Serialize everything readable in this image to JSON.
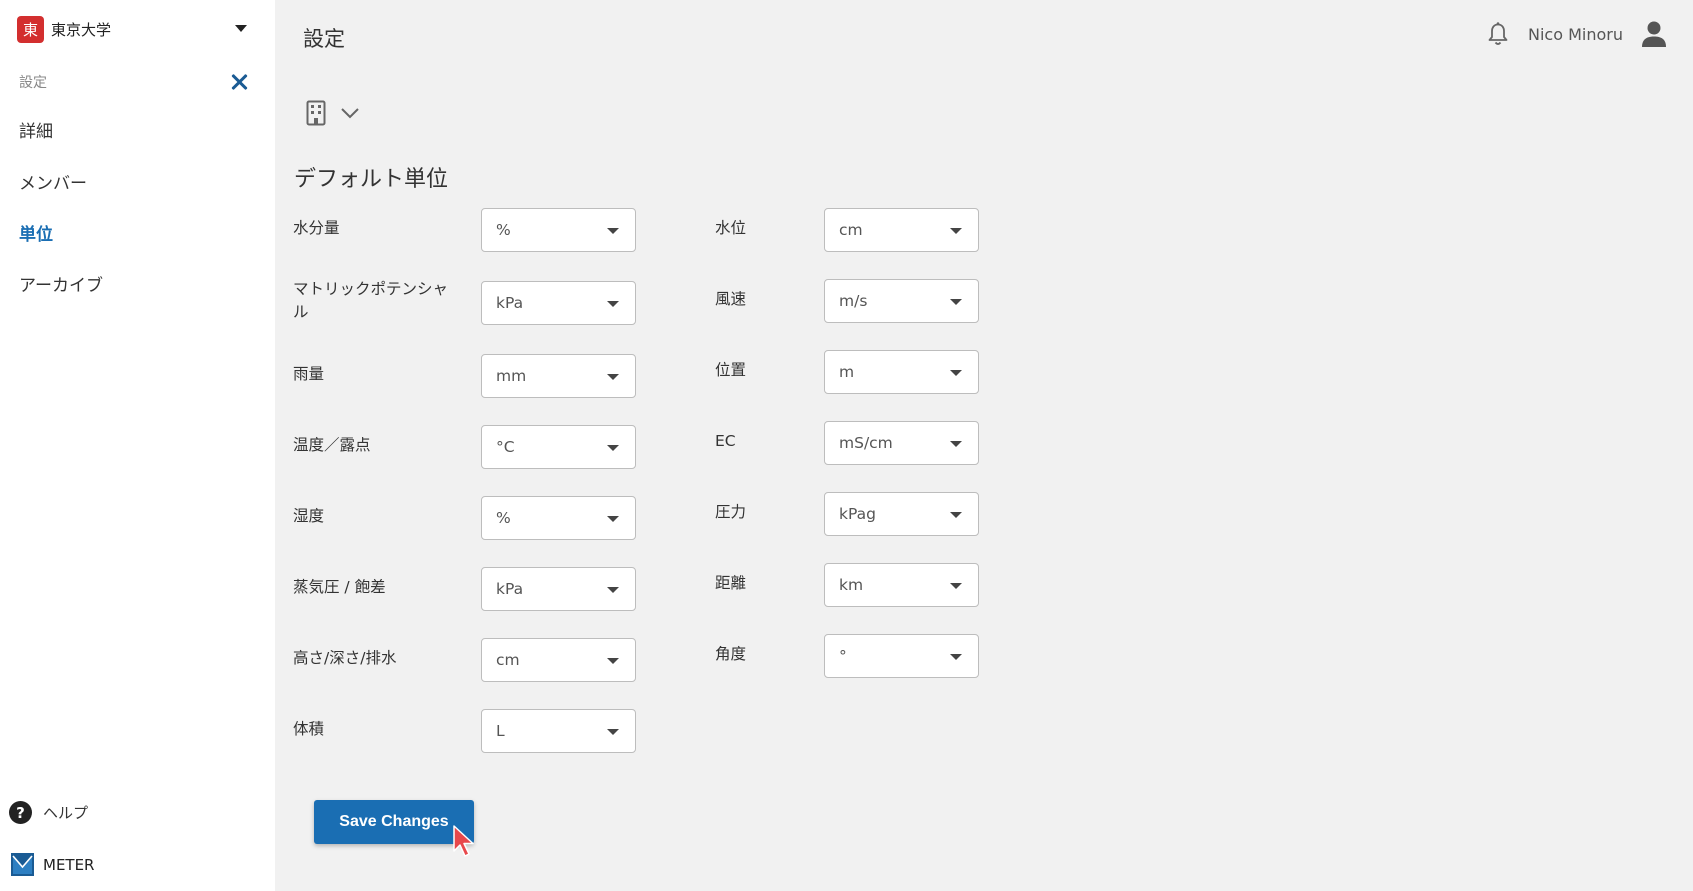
{
  "sidebar": {
    "org_logo": "東",
    "org_name": "東京大学",
    "section_title": "設定",
    "items": [
      {
        "label": "詳細"
      },
      {
        "label": "メンバー"
      },
      {
        "label": "単位",
        "active": true
      },
      {
        "label": "アーカイブ"
      }
    ],
    "help_label": "ヘルプ",
    "help_glyph": "?",
    "brand_label": "METER"
  },
  "header": {
    "title": "設定",
    "user_name": "Nico Minoru"
  },
  "main": {
    "heading": "デフォルト単位",
    "left_fields": [
      {
        "label": "水分量",
        "value": "%"
      },
      {
        "label": "マトリックポテンシャル",
        "value": "kPa"
      },
      {
        "label": "雨量",
        "value": "mm"
      },
      {
        "label": "温度／露点",
        "value": "°C"
      },
      {
        "label": "湿度",
        "value": "%"
      },
      {
        "label": "蒸気圧 / 飽差",
        "value": "kPa"
      },
      {
        "label": "高さ/深さ/排水",
        "value": "cm"
      },
      {
        "label": "体積",
        "value": "L"
      }
    ],
    "right_fields": [
      {
        "label": "水位",
        "value": "cm"
      },
      {
        "label": "風速",
        "value": "m/s"
      },
      {
        "label": "位置",
        "value": "m"
      },
      {
        "label": "EC",
        "value": "mS/cm"
      },
      {
        "label": "圧力",
        "value": "kPag"
      },
      {
        "label": "距離",
        "value": "km"
      },
      {
        "label": "角度",
        "value": "°"
      }
    ],
    "save_label": "Save Changes"
  },
  "colors": {
    "accent": "#1a6eb3",
    "logo_red": "#d32f2f",
    "background": "#f1f1f1"
  }
}
